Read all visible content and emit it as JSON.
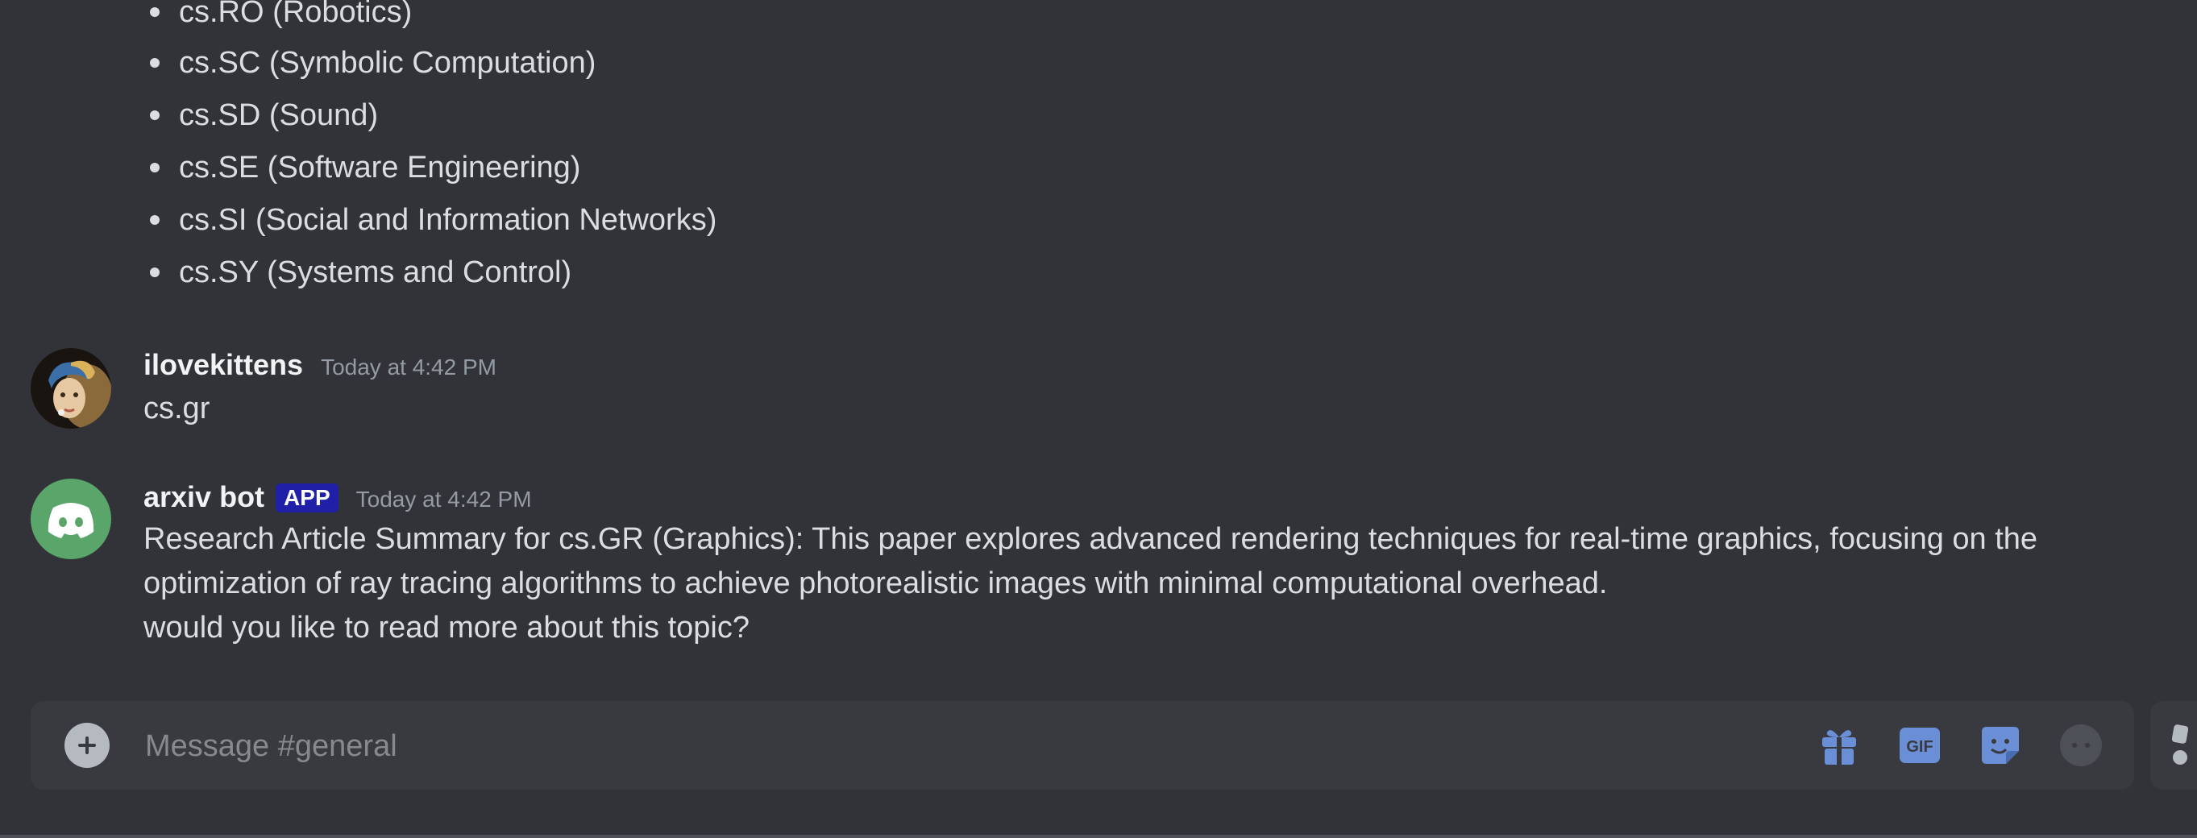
{
  "bullets": [
    "cs.RO (Robotics)",
    "cs.SC (Symbolic Computation)",
    "cs.SD (Sound)",
    "cs.SE (Software Engineering)",
    "cs.SI (Social and Information Networks)",
    "cs.SY (Systems and Control)"
  ],
  "messages": [
    {
      "username": "ilovekittens",
      "timestamp": "Today at 4:42 PM",
      "lines": [
        "cs.gr"
      ],
      "avatar_icon": "portrait-avatar-icon"
    },
    {
      "username": "arxiv bot",
      "badge": "APP",
      "timestamp": "Today at 4:42 PM",
      "lines": [
        "Research Article Summary for cs.GR (Graphics): This paper explores advanced rendering techniques for real-time graphics, focusing on the",
        "optimization of ray tracing algorithms to achieve photorealistic images with minimal computational overhead.",
        "would you like to read more about this topic?"
      ],
      "avatar_icon": "discord-logo-icon"
    }
  ],
  "composer": {
    "placeholder": "Message #general",
    "value": "",
    "icons": [
      "add-attachment-icon",
      "gift-icon",
      "gif-icon",
      "sticker-icon",
      "emoji-icon"
    ],
    "gif_label": "GIF"
  },
  "colors": {
    "background": "#313338",
    "composer": "#383a40",
    "accent": "#5865f2",
    "bot_avatar": "#5aa56a",
    "app_badge": "#1f1fa8",
    "text": "#dbdee1",
    "muted": "#949ba4"
  }
}
